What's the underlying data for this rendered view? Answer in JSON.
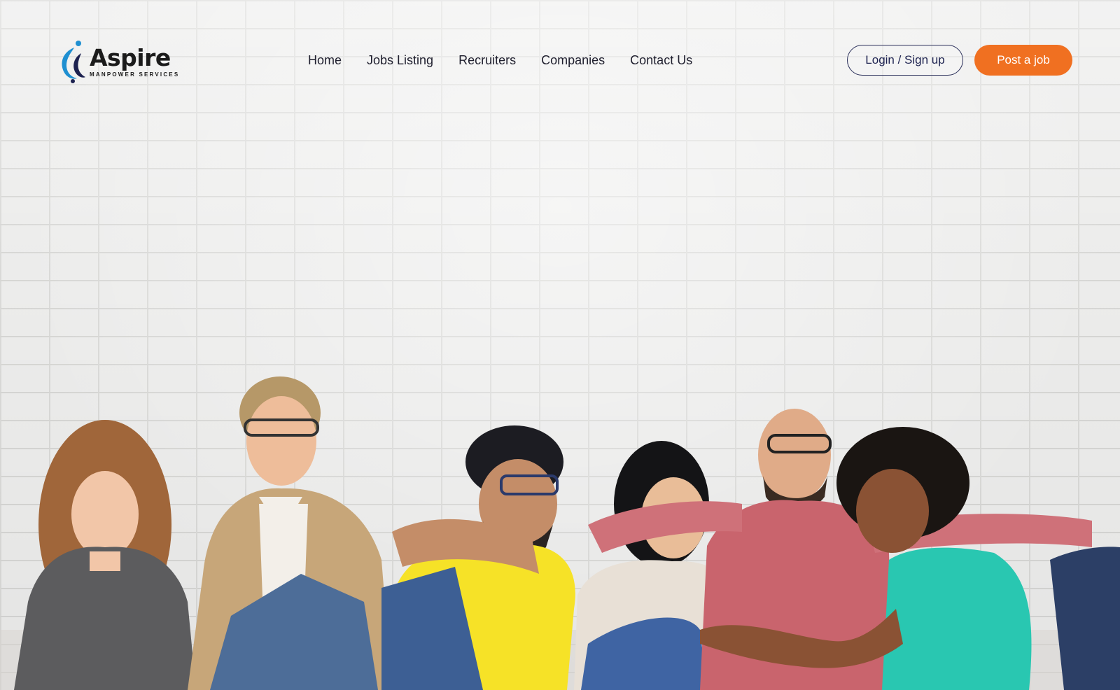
{
  "brand": {
    "name": "Aspire",
    "tagline": "MANPOWER SERVICES",
    "colors": {
      "accent": "#f07021",
      "logo_blue": "#1e8fd1",
      "logo_navy": "#1d2250"
    }
  },
  "nav": {
    "items": [
      {
        "label": "Home"
      },
      {
        "label": "Jobs Listing"
      },
      {
        "label": "Recruiters"
      },
      {
        "label": "Companies"
      },
      {
        "label": "Contact Us"
      }
    ]
  },
  "actions": {
    "login_label": "Login / Sign up",
    "post_job_label": "Post a job"
  },
  "hero": {
    "image": "photo-group-of-diverse-smiling-people-sitting-against-white-brick-wall"
  }
}
